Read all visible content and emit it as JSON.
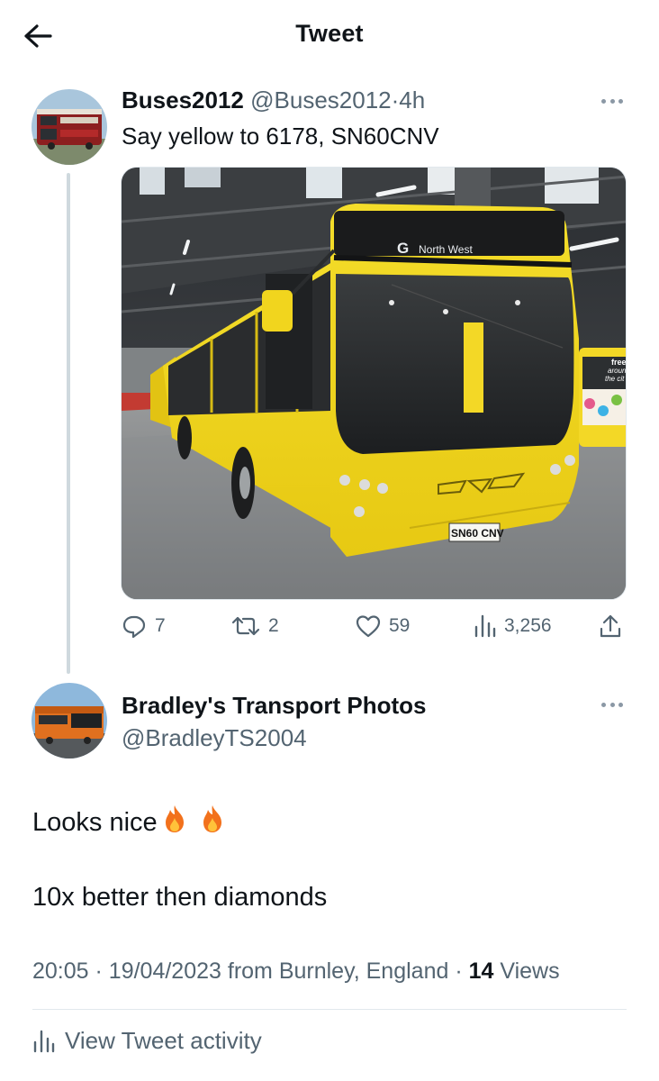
{
  "header": {
    "title": "Tweet",
    "back_icon": "arrow-left-icon"
  },
  "tweet": {
    "display_name": "Buses2012",
    "handle": "@Buses2012",
    "separator": "·",
    "time": "4h",
    "text": "Say yellow to 6178, SN60CNV",
    "image": {
      "destination_display": "North West",
      "plate": "SN60 CNV",
      "bg_sign_text": [
        "free",
        "aroun",
        "the cit"
      ]
    },
    "actions": {
      "replies": "7",
      "retweets": "2",
      "likes": "59",
      "views": "3,256"
    }
  },
  "reply": {
    "display_name": "Bradley's Transport Photos",
    "handle": "@BradleyTS2004",
    "line1": "Looks nice",
    "line2": "10x better then diamonds",
    "time": "20:05",
    "date": "19/04/2023",
    "source": "from Burnley, England",
    "sep1": "·",
    "sep2": "·",
    "views_count": "14",
    "views_label": "Views"
  },
  "activity": {
    "label": "View Tweet activity"
  },
  "colors": {
    "text": "#0f1419",
    "secondary": "#536471",
    "bus_yellow": "#f2d71e"
  }
}
